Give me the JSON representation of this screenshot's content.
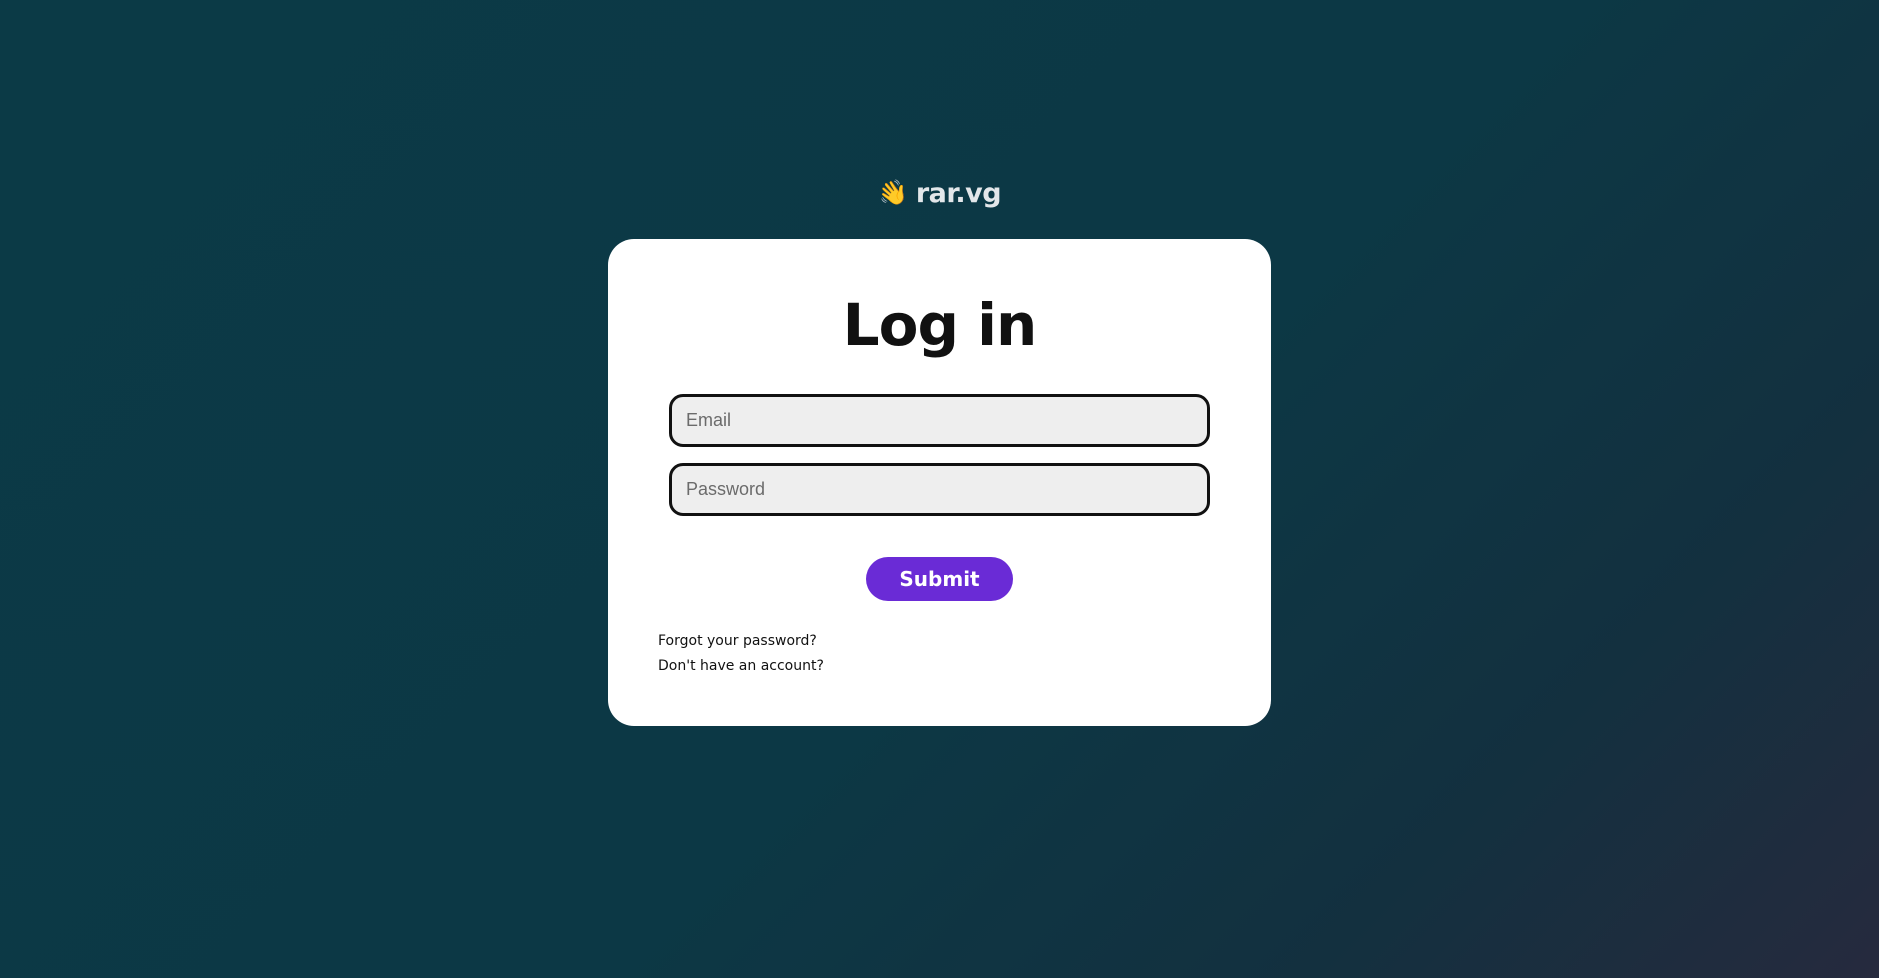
{
  "brand": {
    "icon": "👋",
    "icon_name": "waving-hand-icon",
    "name": "rar.vg"
  },
  "login": {
    "title": "Log in",
    "email_placeholder": "Email",
    "password_placeholder": "Password",
    "submit_label": "Submit",
    "forgot_password_link": "Forgot your password?",
    "signup_link": "Don't have an account?"
  },
  "colors": {
    "accent": "#6a2bd6",
    "background": "#0c3845",
    "card": "#ffffff"
  }
}
